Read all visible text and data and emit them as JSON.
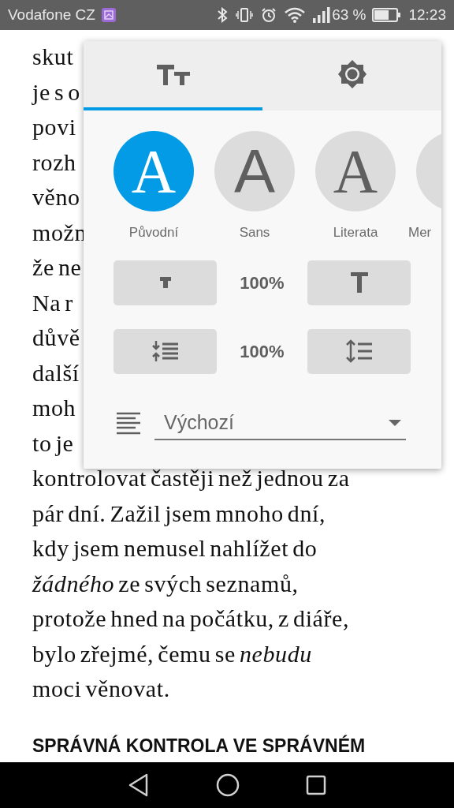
{
  "status_bar": {
    "carrier": "Vodafone CZ",
    "battery": "63 %",
    "time": "12:23"
  },
  "article": {
    "lines": [
      "skut",
      "je s o",
      "povi",
      "rozh",
      "věno",
      "možn",
      "že ne",
      "Na r",
      "důvě",
      "další",
      "moh",
      "to je",
      "kontrolovat častěji než jednou za",
      "pár dní. Zažil jsem mnoho dní,",
      "kdy jsem nemusel nahlížet do",
      "*žádného* ze svých seznamů,",
      "protože hned na počátku, z diáře,",
      "bylo zřejmé, čemu se *nebudu*",
      "moci věnovat."
    ],
    "heading": "SPRÁVNÁ KONTROLA VE SPRÁVNÉM"
  },
  "popup": {
    "tabs": [
      {
        "kind": "text",
        "selected": true
      },
      {
        "kind": "brightness",
        "selected": false
      }
    ],
    "fonts": [
      {
        "glyph": "A",
        "label": "Původní",
        "kind": "serif",
        "selected": true
      },
      {
        "glyph": "A",
        "label": "Sans",
        "kind": "sans",
        "selected": false
      },
      {
        "glyph": "A",
        "label": "Literata",
        "kind": "serif",
        "selected": false
      },
      {
        "label": "Mer",
        "kind": "cut",
        "selected": false
      }
    ],
    "size_controls": [
      {
        "kind": "text_size",
        "value": "100%"
      },
      {
        "kind": "line_spacing",
        "value": "100%"
      }
    ],
    "alignment": {
      "value": "Výchozí"
    }
  }
}
